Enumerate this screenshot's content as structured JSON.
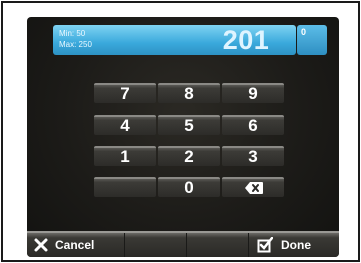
{
  "display": {
    "min_label": "Min: 50",
    "max_label": "Max: 250",
    "value": "201",
    "side_indicator": "0"
  },
  "keypad": {
    "keys": [
      "7",
      "8",
      "9",
      "4",
      "5",
      "6",
      "1",
      "2",
      "3",
      "",
      "0"
    ],
    "backspace_icon": "backspace-icon"
  },
  "actions": {
    "cancel_label": "Cancel",
    "cancel_icon": "close-icon",
    "done_label": "Done",
    "done_icon": "checkbox-check-icon"
  },
  "colors": {
    "accent": "#3aa9dc",
    "background": "#1c1b18",
    "key": "#3c3b37"
  }
}
